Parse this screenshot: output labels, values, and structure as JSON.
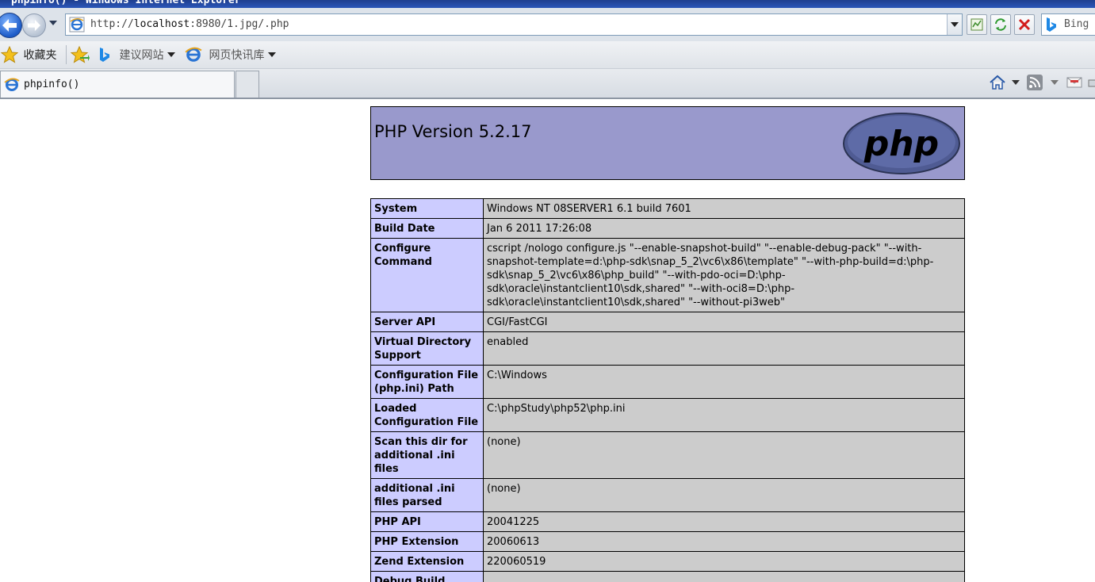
{
  "window": {
    "title": "phpinfo() - Windows Internet Explorer"
  },
  "address_bar": {
    "url_prefix": "http://",
    "url_host": "localhost",
    "url_rest": ":8980/1.jpg/.php"
  },
  "search": {
    "provider": "Bing"
  },
  "favorites_bar": {
    "favorites_label": "收藏夹",
    "items": [
      {
        "label": "建议网站",
        "icon": "bing-icon"
      },
      {
        "label": "网页快讯库",
        "icon": "ie-icon"
      }
    ]
  },
  "tabs": [
    {
      "label": "phpinfo()"
    }
  ],
  "page": {
    "heading": "PHP Version 5.2.17",
    "logo_text": "php",
    "rows": [
      {
        "key": "System",
        "value": "Windows NT 08SERVER1 6.1 build 7601"
      },
      {
        "key": "Build Date",
        "value": "Jan 6 2011 17:26:08"
      },
      {
        "key": "Configure Command",
        "value": "cscript /nologo configure.js \"--enable-snapshot-build\" \"--enable-debug-pack\" \"--with-snapshot-template=d:\\php-sdk\\snap_5_2\\vc6\\x86\\template\" \"--with-php-build=d:\\php-sdk\\snap_5_2\\vc6\\x86\\php_build\" \"--with-pdo-oci=D:\\php-sdk\\oracle\\instantclient10\\sdk,shared\" \"--with-oci8=D:\\php-sdk\\oracle\\instantclient10\\sdk,shared\" \"--without-pi3web\""
      },
      {
        "key": "Server API",
        "value": "CGI/FastCGI"
      },
      {
        "key": "Virtual Directory Support",
        "value": "enabled"
      },
      {
        "key": "Configuration File (php.ini) Path",
        "value": "C:\\Windows"
      },
      {
        "key": "Loaded Configuration File",
        "value": "C:\\phpStudy\\php52\\php.ini"
      },
      {
        "key": "Scan this dir for additional .ini files",
        "value": "(none)"
      },
      {
        "key": "additional .ini files parsed",
        "value": "(none)"
      },
      {
        "key": "PHP API",
        "value": "20041225"
      },
      {
        "key": "PHP Extension",
        "value": "20060613"
      },
      {
        "key": "Zend Extension",
        "value": "220060519"
      },
      {
        "key": "Debug Build",
        "value": ""
      }
    ]
  },
  "colors": {
    "header_bg": "#9999cc",
    "key_bg": "#ccccff",
    "value_bg": "#cccccc"
  }
}
